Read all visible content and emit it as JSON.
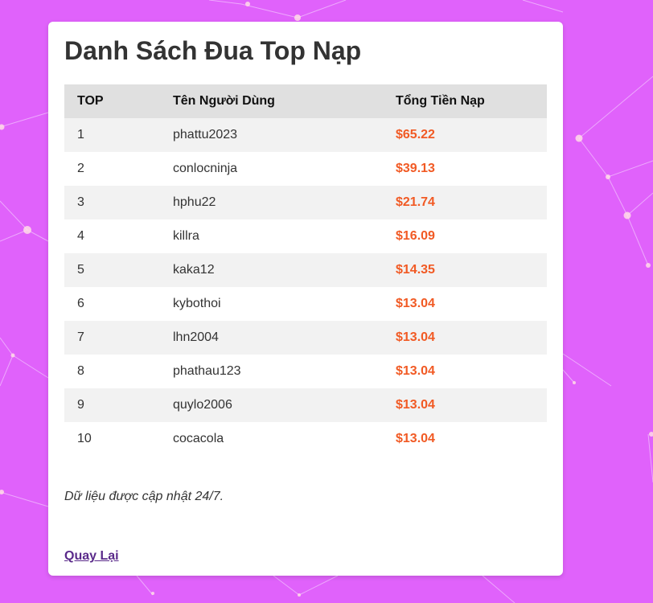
{
  "page": {
    "title": "Danh Sách Đua Top Nạp",
    "note": "Dữ liệu được cập nhật 24/7.",
    "back_label": "Quay Lại",
    "colors": {
      "background": "#e062fb",
      "amount": "#f15a24",
      "link": "#5a2a8a",
      "header_row": "#e0e0e0"
    }
  },
  "table": {
    "headers": [
      "TOP",
      "Tên Người Dùng",
      "Tổng Tiền Nạp"
    ],
    "rows": [
      {
        "rank": "1",
        "user": "phattu2023",
        "amount": "$65.22"
      },
      {
        "rank": "2",
        "user": "conlocninja",
        "amount": "$39.13"
      },
      {
        "rank": "3",
        "user": "hphu22",
        "amount": "$21.74"
      },
      {
        "rank": "4",
        "user": "killra",
        "amount": "$16.09"
      },
      {
        "rank": "5",
        "user": "kaka12",
        "amount": "$14.35"
      },
      {
        "rank": "6",
        "user": "kybothoi",
        "amount": "$13.04"
      },
      {
        "rank": "7",
        "user": "lhn2004",
        "amount": "$13.04"
      },
      {
        "rank": "8",
        "user": "phathau123",
        "amount": "$13.04"
      },
      {
        "rank": "9",
        "user": "quylo2006",
        "amount": "$13.04"
      },
      {
        "rank": "10",
        "user": "cocacola",
        "amount": "$13.04"
      }
    ]
  }
}
